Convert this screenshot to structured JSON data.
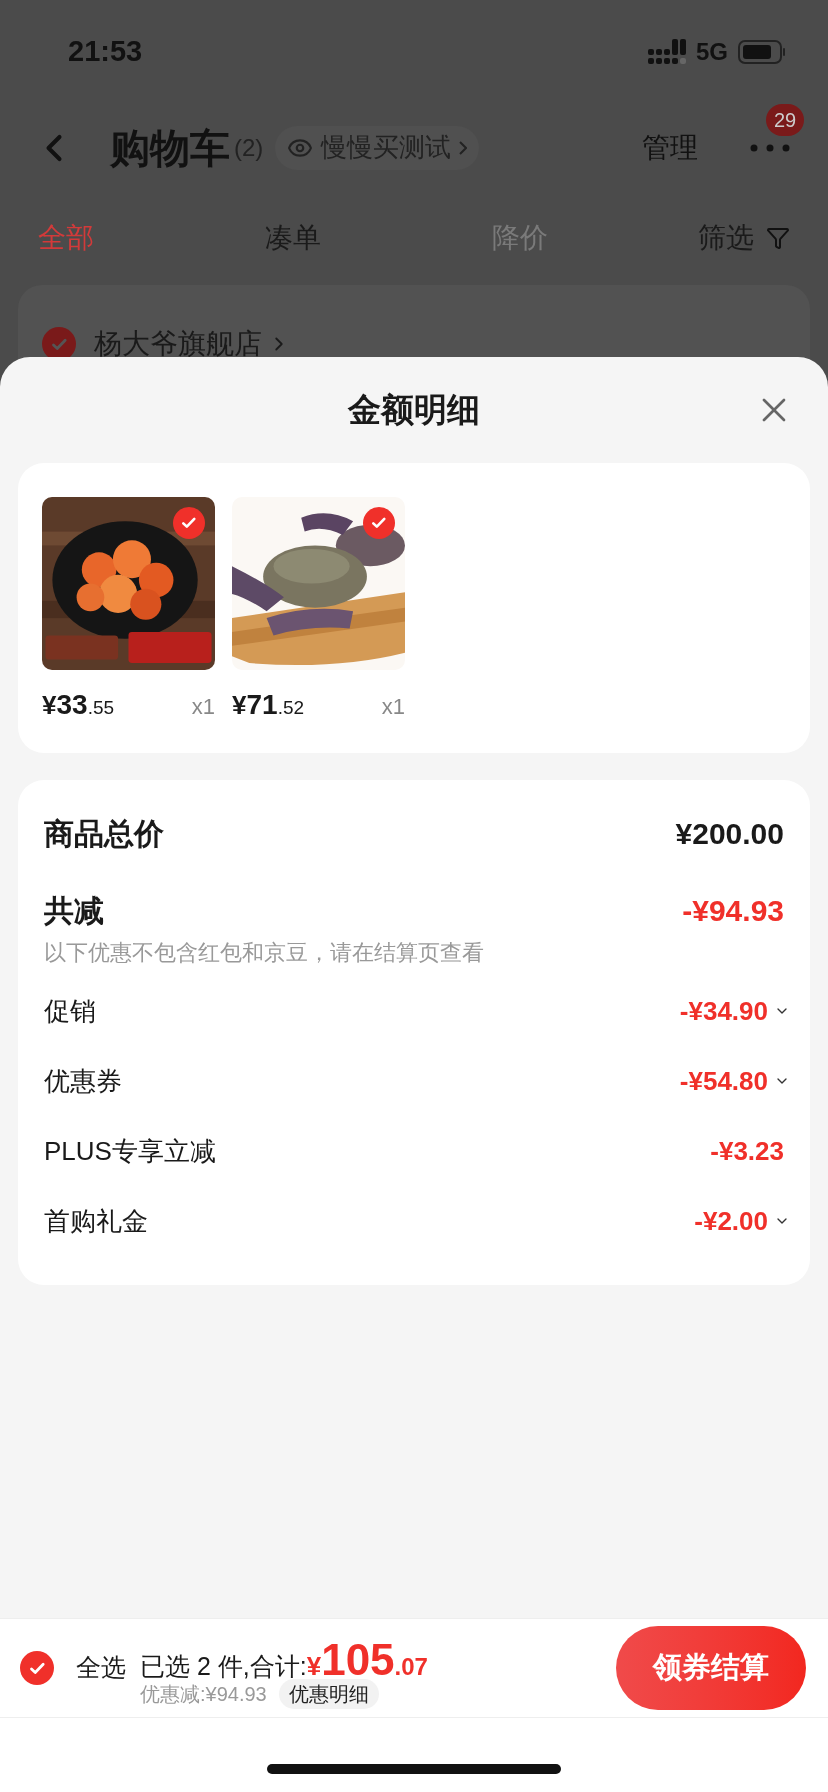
{
  "status_bar": {
    "time": "21:53",
    "network": "5G"
  },
  "header": {
    "title": "购物车",
    "count": "(2)",
    "pill": "慢慢买测试",
    "manage": "管理",
    "badge": "29"
  },
  "tabs": [
    {
      "label": "全部",
      "selected": true,
      "disabled": false
    },
    {
      "label": "凑单",
      "selected": false,
      "disabled": false
    },
    {
      "label": "降价",
      "selected": false,
      "disabled": true
    }
  ],
  "filter": "筛选",
  "store": {
    "name": "杨大爷旗舰店",
    "checked": true
  },
  "sheet": {
    "title": "金额明细",
    "items": [
      {
        "kind": "sausage",
        "currency": "¥",
        "integer": "33",
        "decimal": ".55",
        "qty": "x1",
        "checked": true
      },
      {
        "kind": "crab",
        "currency": "¥",
        "integer": "71",
        "decimal": ".52",
        "qty": "x1",
        "checked": true
      }
    ],
    "total": {
      "label": "商品总价",
      "value": "¥200.00"
    },
    "reduction": {
      "label": "共减",
      "value": "-¥94.93",
      "note": "以下优惠不包含红包和京豆，请在结算页查看"
    },
    "discounts": [
      {
        "label": "促销",
        "value": "-¥34.90",
        "expandable": true
      },
      {
        "label": "优惠券",
        "value": "-¥54.80",
        "expandable": true
      },
      {
        "label": "PLUS专享立减",
        "value": "-¥3.23",
        "expandable": false
      },
      {
        "label": "首购礼金",
        "value": "-¥2.00",
        "expandable": true
      }
    ]
  },
  "bottom_bar": {
    "select_all": {
      "label": "全选",
      "checked": true
    },
    "selected_text": "已选 2 件,合计:",
    "currency": "¥",
    "integer": "105",
    "decimal": ".07",
    "discount": "优惠减:¥94.93",
    "details_button": "优惠明细",
    "checkout": "领券结算"
  }
}
